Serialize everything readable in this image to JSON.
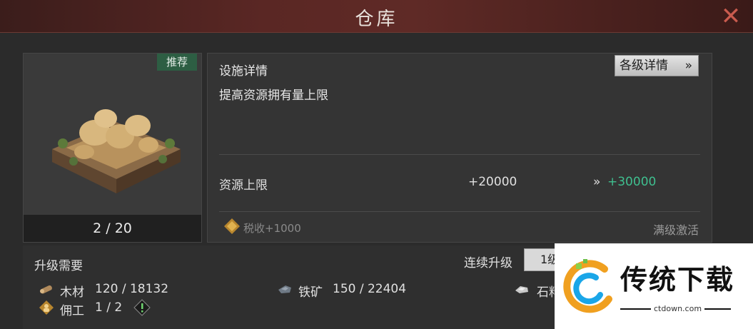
{
  "header": {
    "title": "仓库",
    "close_icon": "close-icon",
    "accent": "#c95b4e"
  },
  "building_card": {
    "badge": "推荐",
    "image_icon": "warehouse-building-illustration",
    "level": "2 / 20"
  },
  "details": {
    "section_title": "设施详情",
    "level_details_button": "各级详情",
    "level_details_arrow": "»",
    "description": "提高资源拥有量上限",
    "stat": {
      "label": "资源上限",
      "current": "+20000",
      "arrow": "»",
      "next": "+30000",
      "next_color": "#3fbf8f"
    },
    "tax_icon": "tax-rank-icon",
    "tax_text": "税收+1000",
    "max_level_text": "满级激活"
  },
  "upgrade": {
    "title": "升级需要",
    "continuous_label": "连续升级",
    "continuous_value": "1级",
    "resources": [
      {
        "icon": "wood-icon",
        "name": "木材",
        "amount": "120 / 18132"
      },
      {
        "icon": "iron-ore-icon",
        "name": "铁矿",
        "amount": "150 / 22404"
      },
      {
        "icon": "stone-icon",
        "name": "石料",
        "amount": ""
      },
      {
        "icon": "worker-icon",
        "name": "佣工",
        "amount": "1 / 2"
      }
    ],
    "warning_icon": "warning-icon"
  },
  "watermark": {
    "brand": "传统下载",
    "url": "ctdown.com"
  }
}
